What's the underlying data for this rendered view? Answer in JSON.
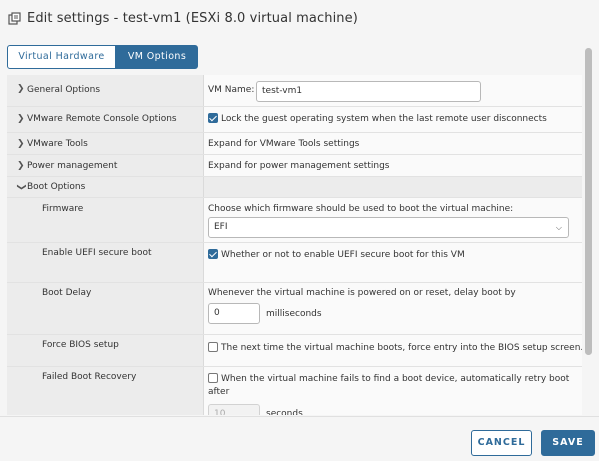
{
  "header": {
    "title": "Edit settings - test-vm1 (ESXi 8.0 virtual machine)",
    "icon": "edit-settings-icon"
  },
  "tabs": [
    {
      "label": "Virtual Hardware",
      "active": false
    },
    {
      "label": "VM Options",
      "active": true
    }
  ],
  "rows": {
    "general": {
      "label": "General Options",
      "vm_name_label": "VM Name:",
      "vm_name_value": "test-vm1"
    },
    "vmrc": {
      "label": "VMware Remote Console Options",
      "lock_text": "Lock the guest operating system when the last remote user disconnects",
      "lock_checked": true
    },
    "tools": {
      "label": "VMware Tools",
      "text": "Expand for VMware Tools settings"
    },
    "power": {
      "label": "Power management",
      "text": "Expand for power management settings"
    },
    "boot": {
      "label": "Boot Options"
    },
    "firmware": {
      "label": "Firmware",
      "text": "Choose which firmware should be used to boot the virtual machine:",
      "selected": "EFI"
    },
    "uefi": {
      "label": "Enable UEFI secure boot",
      "text": "Whether or not to enable UEFI secure boot for this VM",
      "checked": true
    },
    "delay": {
      "label": "Boot Delay",
      "text": "Whenever the virtual machine is powered on or reset, delay boot by",
      "value": "0",
      "unit": "milliseconds"
    },
    "bios": {
      "label": "Force BIOS setup",
      "text": "The next time the virtual machine boots, force entry into the BIOS setup screen.",
      "checked": false
    },
    "recovery": {
      "label": "Failed Boot Recovery",
      "text_line1": "When the virtual machine fails to find a boot device, automatically retry boot",
      "text_line2": "after",
      "value": "10",
      "unit": "seconds",
      "checked": false
    }
  },
  "footer": {
    "cancel_label": "CANCEL",
    "save_label": "SAVE"
  },
  "colors": {
    "accent": "#2f6b9a"
  }
}
